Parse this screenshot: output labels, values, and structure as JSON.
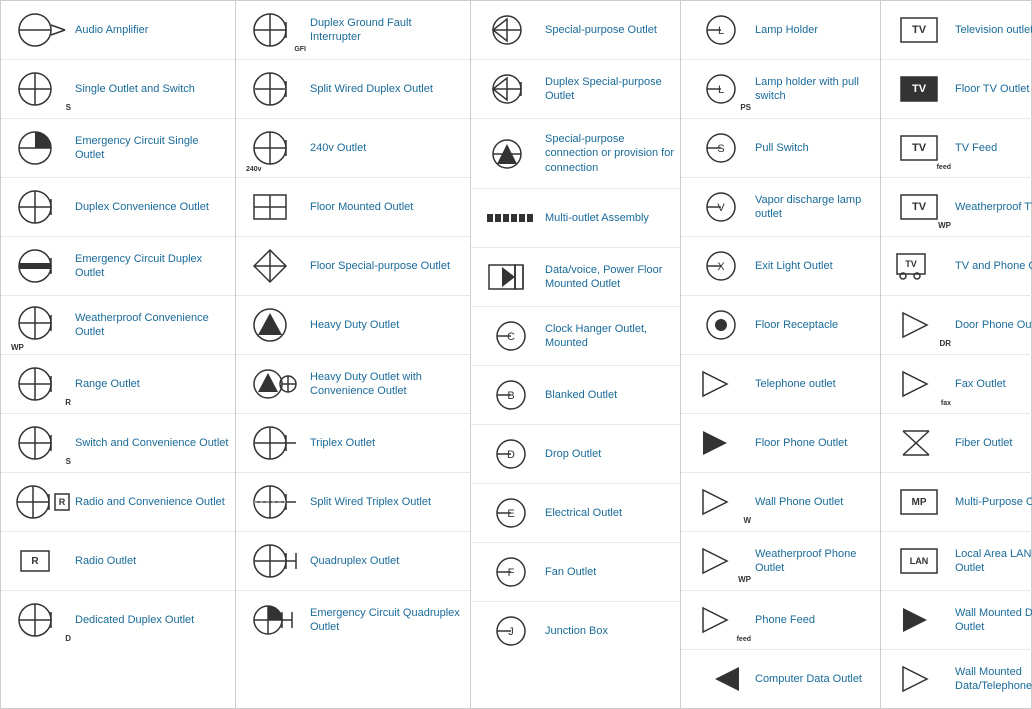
{
  "columns": [
    {
      "items": [
        {
          "id": "audio-amplifier",
          "label": "Audio Amplifier",
          "icon": "audio-amplifier",
          "tag": ""
        },
        {
          "id": "single-outlet-switch",
          "label": "Single Outlet and Switch",
          "icon": "single-outlet-switch",
          "tag": "S"
        },
        {
          "id": "emergency-circuit-single",
          "label": "Emergency Circuit Single Outlet",
          "icon": "emergency-circuit-single",
          "tag": ""
        },
        {
          "id": "duplex-convenience",
          "label": "Duplex Convenience Outlet",
          "icon": "duplex-convenience",
          "tag": ""
        },
        {
          "id": "emergency-circuit-duplex",
          "label": "Emergency Circuit Duplex Outlet",
          "icon": "emergency-circuit-duplex",
          "tag": ""
        },
        {
          "id": "weatherproof-convenience",
          "label": "Weatherproof Convenience Outlet",
          "icon": "weatherproof-convenience",
          "tag": "WP"
        },
        {
          "id": "range-outlet",
          "label": "Range Outlet",
          "icon": "range-outlet",
          "tag": "R"
        },
        {
          "id": "switch-convenience",
          "label": "Switch and Convenience Outlet",
          "icon": "switch-convenience",
          "tag": "S"
        },
        {
          "id": "radio-convenience",
          "label": "Radio and Convenience Outlet",
          "icon": "radio-convenience",
          "tag": "R"
        },
        {
          "id": "radio-outlet",
          "label": "Radio Outlet",
          "icon": "radio-outlet",
          "tag": "R"
        },
        {
          "id": "dedicated-duplex",
          "label": "Dedicated Duplex Outlet",
          "icon": "dedicated-duplex",
          "tag": "D"
        }
      ]
    },
    {
      "items": [
        {
          "id": "duplex-gfi",
          "label": "Duplex Ground Fault Interrupter",
          "icon": "duplex-gfi",
          "tag": "GFI"
        },
        {
          "id": "split-wired-duplex",
          "label": "Split Wired Duplex Outlet",
          "icon": "split-wired-duplex",
          "tag": ""
        },
        {
          "id": "240v-outlet",
          "label": "240v Outlet",
          "icon": "240v-outlet",
          "tag": "240v"
        },
        {
          "id": "floor-mounted",
          "label": "Floor Mounted Outlet",
          "icon": "floor-mounted",
          "tag": ""
        },
        {
          "id": "floor-special-purpose",
          "label": "Floor Special-purpose Outlet",
          "icon": "floor-special-purpose",
          "tag": ""
        },
        {
          "id": "heavy-duty",
          "label": "Heavy Duty Outlet",
          "icon": "heavy-duty",
          "tag": ""
        },
        {
          "id": "heavy-duty-convenience",
          "label": "Heavy Duty Outlet with Convenience Outlet",
          "icon": "heavy-duty-convenience",
          "tag": ""
        },
        {
          "id": "triplex-outlet",
          "label": "Triplex Outlet",
          "icon": "triplex-outlet",
          "tag": ""
        },
        {
          "id": "split-wired-triplex",
          "label": "Split Wired Triplex Outlet",
          "icon": "split-wired-triplex",
          "tag": ""
        },
        {
          "id": "quadruplex",
          "label": "Quadruplex Outlet",
          "icon": "quadruplex",
          "tag": ""
        },
        {
          "id": "emergency-circuit-quadruplex",
          "label": "Emergency Circuit Quadruplex Outlet",
          "icon": "emergency-circuit-quadruplex",
          "tag": ""
        }
      ]
    },
    {
      "items": [
        {
          "id": "special-purpose",
          "label": "Special-purpose Outlet",
          "icon": "special-purpose",
          "tag": ""
        },
        {
          "id": "duplex-special-purpose",
          "label": "Duplex Special-purpose Outlet",
          "icon": "duplex-special-purpose",
          "tag": ""
        },
        {
          "id": "special-purpose-connection",
          "label": "Special-purpose connection or provision for connection",
          "icon": "special-purpose-connection",
          "tag": ""
        },
        {
          "id": "multi-outlet-assembly",
          "label": "Multi-outlet Assembly",
          "icon": "multi-outlet-assembly",
          "tag": ""
        },
        {
          "id": "data-voice-power",
          "label": "Data/voice, Power Floor Mounted Outlet",
          "icon": "data-voice-power",
          "tag": ""
        },
        {
          "id": "clock-hanger",
          "label": "Clock Hanger Outlet, Mounted",
          "icon": "clock-hanger",
          "tag": "C"
        },
        {
          "id": "blanked-outlet",
          "label": "Blanked Outlet",
          "icon": "blanked-outlet",
          "tag": "B"
        },
        {
          "id": "drop-outlet",
          "label": "Drop Outlet",
          "icon": "drop-outlet",
          "tag": "D"
        },
        {
          "id": "electrical-outlet",
          "label": "Electrical Outlet",
          "icon": "electrical-outlet",
          "tag": "E"
        },
        {
          "id": "fan-outlet",
          "label": "Fan Outlet",
          "icon": "fan-outlet",
          "tag": "F"
        },
        {
          "id": "junction-box",
          "label": "Junction Box",
          "icon": "junction-box",
          "tag": "J"
        }
      ]
    },
    {
      "items": [
        {
          "id": "lamp-holder",
          "label": "Lamp Holder",
          "icon": "lamp-holder",
          "tag": "L"
        },
        {
          "id": "lamp-holder-pull",
          "label": "Lamp holder with pull switch",
          "icon": "lamp-holder-pull",
          "tag": "PS"
        },
        {
          "id": "pull-switch",
          "label": "Pull Switch",
          "icon": "pull-switch",
          "tag": "S"
        },
        {
          "id": "vapor-discharge",
          "label": "Vapor discharge lamp outlet",
          "icon": "vapor-discharge",
          "tag": "V"
        },
        {
          "id": "exit-light",
          "label": "Exit Light Outlet",
          "icon": "exit-light",
          "tag": "X"
        },
        {
          "id": "floor-receptacle",
          "label": "Floor Receptacle",
          "icon": "floor-receptacle",
          "tag": ""
        },
        {
          "id": "telephone-outlet",
          "label": "Telephone outlet",
          "icon": "telephone-outlet",
          "tag": ""
        },
        {
          "id": "floor-phone",
          "label": "Floor Phone Outlet",
          "icon": "floor-phone",
          "tag": ""
        },
        {
          "id": "wall-phone",
          "label": "Wall Phone Outlet",
          "icon": "wall-phone",
          "tag": "W"
        },
        {
          "id": "weatherproof-phone",
          "label": "Weatherproof Phone Outlet",
          "icon": "weatherproof-phone",
          "tag": "WP"
        },
        {
          "id": "phone-feed",
          "label": "Phone Feed",
          "icon": "phone-feed",
          "tag": "feed"
        },
        {
          "id": "computer-data",
          "label": "Computer Data Outlet",
          "icon": "computer-data",
          "tag": ""
        }
      ]
    },
    {
      "items": [
        {
          "id": "television-outlet",
          "label": "Television outlet",
          "icon": "television-outlet",
          "tag": "TV"
        },
        {
          "id": "floor-tv",
          "label": "Floor TV Outlet",
          "icon": "floor-tv",
          "tag": "TV"
        },
        {
          "id": "tv-feed",
          "label": "TV Feed",
          "icon": "tv-feed",
          "tag": "feed"
        },
        {
          "id": "weatherproof-tv",
          "label": "Weatherproof TV Outlet",
          "icon": "weatherproof-tv",
          "tag": "WP"
        },
        {
          "id": "tv-phone",
          "label": "TV and Phone Outlet",
          "icon": "tv-phone",
          "tag": ""
        },
        {
          "id": "door-phone",
          "label": "Door Phone Outlet",
          "icon": "door-phone",
          "tag": "DR"
        },
        {
          "id": "fax-outlet",
          "label": "Fax Outlet",
          "icon": "fax-outlet",
          "tag": "fax"
        },
        {
          "id": "fiber-outlet",
          "label": "Fiber Outlet",
          "icon": "fiber-outlet",
          "tag": ""
        },
        {
          "id": "multi-purpose",
          "label": "Multi-Purpose Outlet",
          "icon": "multi-purpose",
          "tag": "MP"
        },
        {
          "id": "lan-outlet",
          "label": "Local Area LAN Network Outlet",
          "icon": "lan-outlet",
          "tag": "LAN"
        },
        {
          "id": "wall-mounted-data",
          "label": "Wall Mounted Data Outlet",
          "icon": "wall-mounted-data",
          "tag": ""
        },
        {
          "id": "wall-mounted-data-telephone",
          "label": "Wall Mounted Data/Telephone Outlet",
          "icon": "wall-mounted-data-telephone",
          "tag": ""
        }
      ]
    }
  ]
}
